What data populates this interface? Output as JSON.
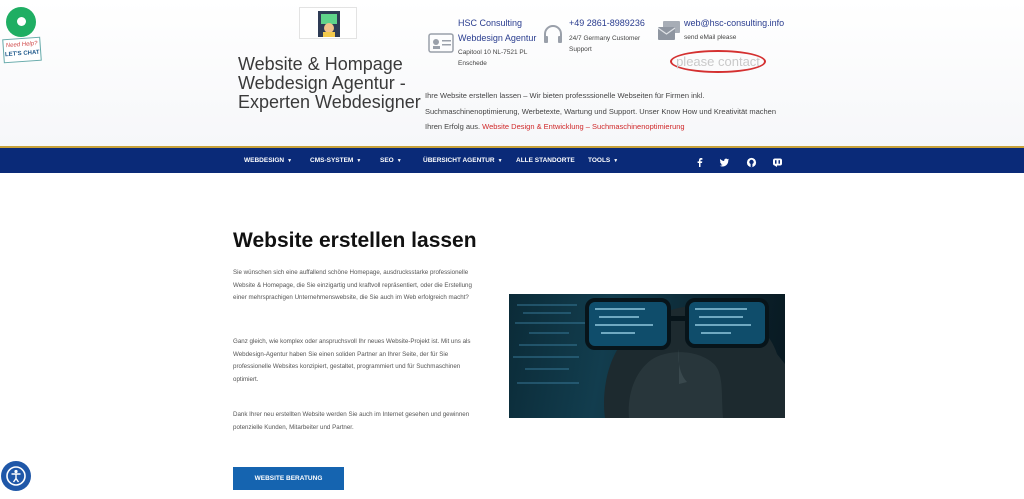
{
  "header": {
    "site_title": "Website & Hompage Webdesign Agentur - Experten Webdesigner",
    "contact_address": {
      "title1": "HSC Consulting",
      "title2": "Webdesign Agentur",
      "address": "Capitool 10 NL-7521 PL Enschede",
      "icon": "id-card-icon"
    },
    "contact_phone": {
      "phone": "+49 2861-8989236",
      "note": "24/7 Germany Customer Support",
      "icon": "headset-icon"
    },
    "contact_email": {
      "email": "web@hsc-consulting.info",
      "note": "send eMail please",
      "icon": "mail-icon"
    },
    "please_contact": "please contact",
    "intro_text": "Ihre Website erstellen lassen – Wir bieten professsionelle Webseiten für Firmen inkl. Suchmaschinenoptimierung, Werbetexte, Wartung und Support. Unser Know How und Kreativität machen Ihren Erfolg aus.",
    "intro_link": "Website Design & Entwicklung – Suchmaschinenoptimierung"
  },
  "chat_widget": {
    "need": "Need Help?",
    "lets_chat": "LET'S CHAT"
  },
  "nav": {
    "items": [
      {
        "label": "WEBDESIGN",
        "has_caret": true
      },
      {
        "label": "CMS-SYSTEM",
        "has_caret": true
      },
      {
        "label": "SEO",
        "has_caret": true
      },
      {
        "label": "ÜBERSICHT AGENTUR",
        "has_caret": true
      },
      {
        "label": "ALLE STANDORTE",
        "has_caret": false
      },
      {
        "label": "TOOLS",
        "has_caret": true
      }
    ],
    "social": [
      "facebook-icon",
      "twitter-icon",
      "github-icon",
      "mastodon-icon"
    ],
    "background": "#0a2a78"
  },
  "main": {
    "heading": "Website erstellen lassen",
    "paragraphs": [
      "Sie wünschen sich eine auffallend schöne Homepage, ausdrucksstarke professionelle Website & Homepage, die Sie einzigartig und kraftvoll repräsentiert, oder die Erstellung einer mehrsprachigen Unternehmenswebsite, die Sie auch im Web erfolgreich macht?",
      "Ganz gleich, wie komplex oder anspruchsvoll Ihr neues Website-Projekt ist. Mit uns als Webdesign-Agentur haben Sie einen soliden Partner an Ihrer Seite, der für Sie professionelle Websites konzipiert, gestaltet, programmiert und für Suchmaschinen optimiert.",
      "Dank Ihrer neu erstellten Website werden Sie auch im Internet gesehen und gewinnen potenzielle Kunden, Mitarbeiter und Partner."
    ],
    "cta_label": "WEBSITE BERATUNG",
    "cta_color": "#1564b0"
  }
}
